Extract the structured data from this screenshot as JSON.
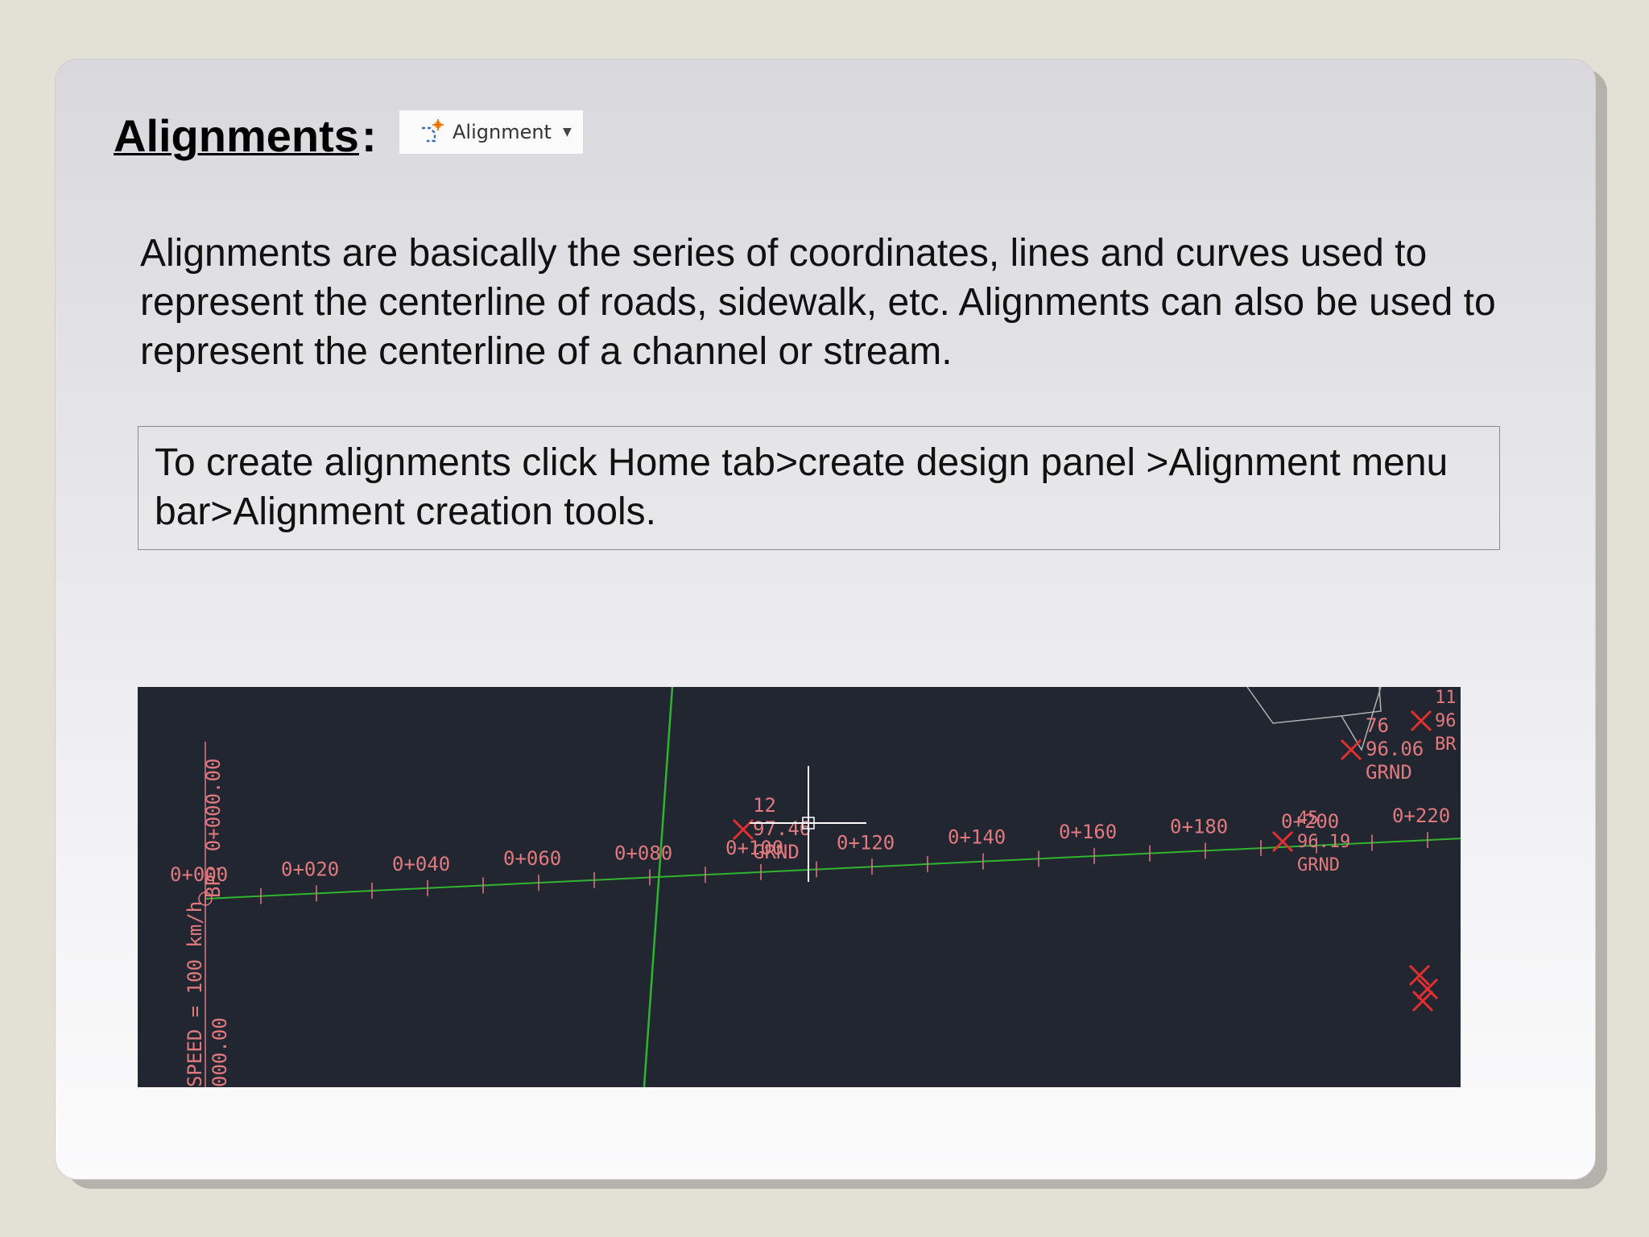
{
  "slide": {
    "title": "Alignments",
    "title_colon": ":",
    "ribbon_button": {
      "label": "Alignment",
      "icon": "alignment-tool-icon"
    },
    "paragraph": "Alignments are basically the series of coordinates, lines and curves used to represent the centerline of roads, sidewalk, etc. Alignments can also be used to represent the centerline of a channel or stream.",
    "instruction": "To create alignments click Home tab>create design panel >Alignment menu bar>Alignment creation tools."
  },
  "cad_drawing": {
    "background": "#222630",
    "alignment_color": "#2fb52f",
    "label_color": "#e07a7f",
    "station_labels": [
      "0+000",
      "0+020",
      "0+040",
      "0+060",
      "0+080",
      "0+100",
      "0+120",
      "0+140",
      "0+160",
      "0+180",
      "0+200",
      "0+220"
    ],
    "vertical_labels": [
      "BP: 0+000.00",
      "SPEED = 100 km/h",
      "000.00"
    ],
    "point_labels": {
      "p12": [
        "12",
        "97.46",
        "GRND"
      ],
      "p45": [
        "45",
        "96.19",
        "GRND"
      ],
      "p76": [
        "76",
        "96.06",
        "GRND"
      ],
      "top_right": [
        "11",
        "96",
        "BR"
      ]
    }
  }
}
